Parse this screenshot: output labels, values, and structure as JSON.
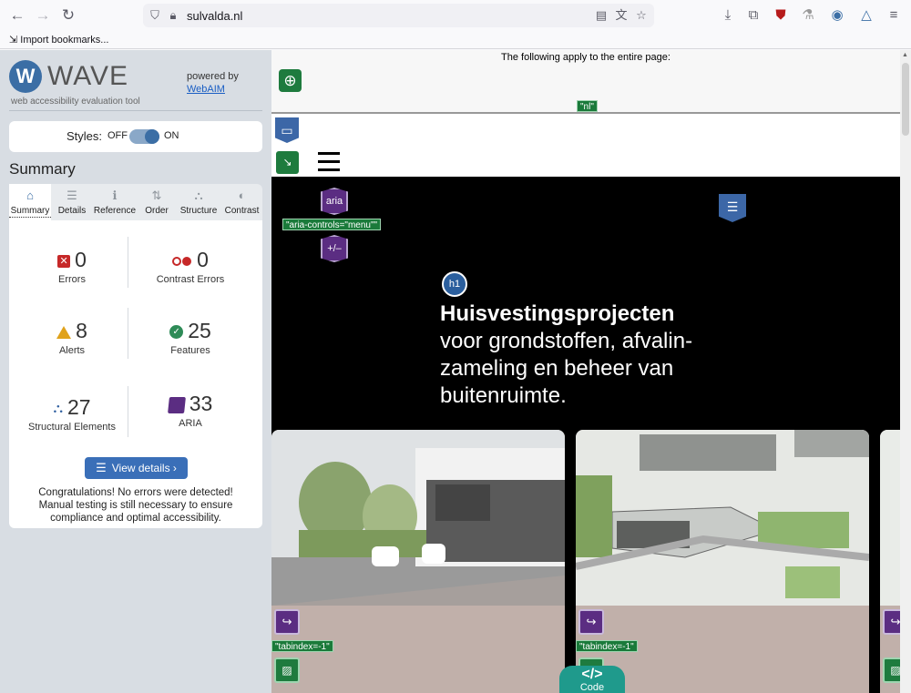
{
  "browser": {
    "url": "sulvalda.nl",
    "bookmark": "Import bookmarks...",
    "icons": [
      "back-icon",
      "forward-icon",
      "reload-icon",
      "shield-icon",
      "lock-icon",
      "reader-icon",
      "translate-icon",
      "star-icon",
      "download-icon",
      "extensions-icon",
      "ublock-icon",
      "wave-ext-icon",
      "menu-icon"
    ]
  },
  "wave": {
    "title": "WAVE",
    "subtitle": "web accessibility evaluation tool",
    "powered": "powered by",
    "webaim": "WebAIM",
    "styles_label": "Styles:",
    "styles_off": "OFF",
    "styles_on": "ON",
    "summary_heading": "Summary",
    "tabs": [
      {
        "label": "Summary",
        "glyph": "⌂"
      },
      {
        "label": "Details",
        "glyph": "☰"
      },
      {
        "label": "Reference",
        "glyph": "ℹ"
      },
      {
        "label": "Order",
        "glyph": "⇅"
      },
      {
        "label": "Structure",
        "glyph": "⛬"
      },
      {
        "label": "Contrast",
        "glyph": "◐"
      }
    ],
    "stats": {
      "errors": {
        "value": "0",
        "label": "Errors"
      },
      "contrast": {
        "value": "0",
        "label": "Contrast Errors"
      },
      "alerts": {
        "value": "8",
        "label": "Alerts"
      },
      "features": {
        "value": "25",
        "label": "Features"
      },
      "structural": {
        "value": "27",
        "label": "Structural Elements"
      },
      "aria": {
        "value": "33",
        "label": "ARIA"
      }
    },
    "view_details": "View details ›",
    "congrats": "Congratulations! No errors were detected! Manual testing is still necessary to ensure compliance and optimal accessibility.",
    "colors": {
      "accent": "#3a6fb8",
      "error": "#c62828",
      "alert": "#e0a21b",
      "feature": "#2e8b57",
      "aria": "#5b2d82"
    }
  },
  "page": {
    "doc_note": "The following apply to the entire page:",
    "lang_tag": "\"nl\"",
    "aria_controls": "\"aria-controls=\"menu\"\"",
    "aria_label": "aria",
    "plus_minus": "+/–",
    "h1_label": "h1",
    "hero_title_bold": "Huisvestingsprojecten",
    "hero_title_rest": "voor grondstoffen, afvalin-zameling en beheer van buitenruimte.",
    "tabindex_tag": "\"tabindex=-1\"",
    "code_label": "Code",
    "code_glyph": "</>"
  }
}
